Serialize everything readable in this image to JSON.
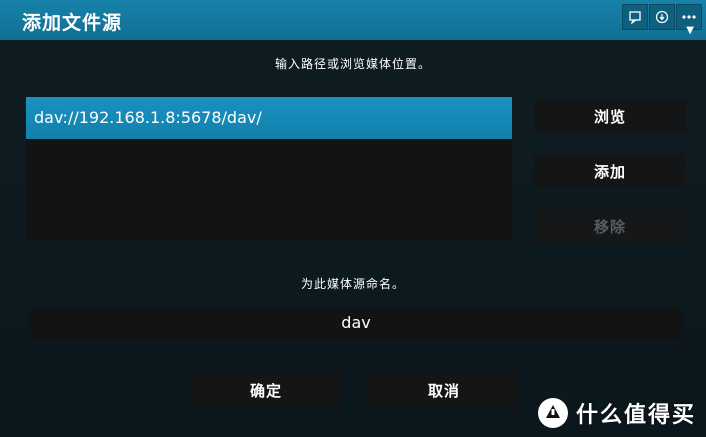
{
  "dialog": {
    "title": "添加文件源",
    "top_icons": [
      "comment-icon",
      "download-icon",
      "more-icon"
    ]
  },
  "browse_section": {
    "hint": "输入路径或浏览媒体位置。",
    "paths": [
      "dav://192.168.1.8:5678/dav/"
    ],
    "buttons": {
      "browse": "浏览",
      "add": "添加",
      "remove": "移除"
    }
  },
  "name_section": {
    "hint": "为此媒体源命名。",
    "name_value": "dav"
  },
  "actions": {
    "ok": "确定",
    "cancel": "取消"
  },
  "watermark": {
    "text": "什么值得买",
    "logo_glyph": "值"
  },
  "colors": {
    "titlebar": "#13789d",
    "selected_item": "#1587b4",
    "background": "#0d1a20",
    "button_bg": "#141516",
    "disabled_text": "#595c5e"
  }
}
